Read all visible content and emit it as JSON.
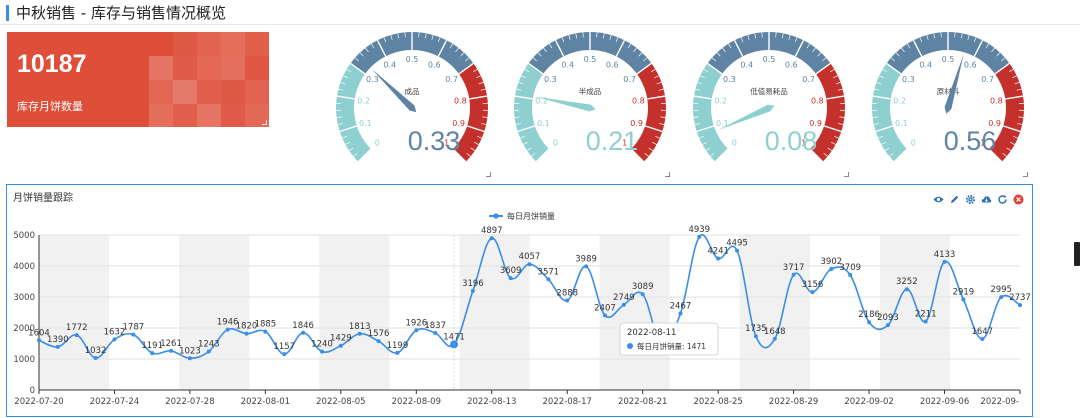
{
  "header": {
    "title": "中秋销售 - 库存与销售情况概览"
  },
  "colors": {
    "accent": "#3a8ee6",
    "card_red": "#de4e38",
    "gauge_teal": "#8ecfd0",
    "gauge_blue": "#5e83a3",
    "gauge_red": "#c4302b",
    "line": "#3a8ee6"
  },
  "stat_card": {
    "value": "10187",
    "label": "库存月饼数量"
  },
  "gauges": [
    {
      "name": "成品",
      "value": 0.33,
      "display": "0.33",
      "color": "#5e83a3"
    },
    {
      "name": "半成品",
      "value": 0.21,
      "display": "0.21",
      "color": "#8ecfd0"
    },
    {
      "name": "低值易耗品",
      "value": 0.08,
      "display": "0.08",
      "color": "#8ecfd0"
    },
    {
      "name": "原材料",
      "value": 0.56,
      "display": "0.56",
      "color": "#5e83a3"
    }
  ],
  "gauge_ticks": [
    "0",
    "0.1",
    "0.2",
    "0.3",
    "0.4",
    "0.5",
    "0.6",
    "0.7",
    "0.8",
    "0.9",
    "1"
  ],
  "chart_panel": {
    "title": "月饼销量跟踪",
    "toolbox": [
      "eye-icon",
      "pencil-icon",
      "gear-icon",
      "cloud-download-icon",
      "refresh-icon",
      "close-icon"
    ]
  },
  "chart_data": {
    "type": "line",
    "legend": "每日月饼销量",
    "ylim": [
      0,
      5000
    ],
    "yticks": [
      0,
      1000,
      2000,
      3000,
      4000,
      5000
    ],
    "x_tick_labels": [
      "2022-07-20",
      "2022-07-24",
      "2022-07-28",
      "2022-08-01",
      "2022-08-05",
      "2022-08-09",
      "2022-08-13",
      "2022-08-17",
      "2022-08-21",
      "2022-08-25",
      "2022-08-29",
      "2022-09-02",
      "2022-09-06",
      "2022-09-"
    ],
    "series": [
      {
        "name": "每日月饼销量",
        "values": [
          1604,
          1390,
          1772,
          1032,
          1632,
          1787,
          1191,
          1261,
          1023,
          1243,
          1946,
          1820,
          1885,
          1157,
          1846,
          1240,
          1429,
          1813,
          1576,
          1199,
          1926,
          1837,
          1471,
          3196,
          4897,
          3609,
          4057,
          3571,
          2888,
          3989,
          2407,
          2749,
          3089,
          1471,
          2467,
          4939,
          4241,
          4495,
          1735,
          1648,
          3717,
          3156,
          3902,
          3709,
          2186,
          2093,
          3252,
          2211,
          4133,
          2919,
          1647,
          2995,
          2737
        ]
      }
    ],
    "point_labels": [
      "1604",
      "1390",
      "1772",
      "1032",
      "1632",
      "1787",
      "1191",
      "1261",
      "1023",
      "1243",
      "1946",
      "1820",
      "1885",
      "1157",
      "1846",
      "1240",
      "1429",
      "1813",
      "1576",
      "1199",
      "1926",
      "1837",
      "1471",
      "3196",
      "4897",
      "3609",
      "4057",
      "3571",
      "2888",
      "3989",
      "2407",
      "2749",
      "3089",
      "",
      "2467",
      "4939",
      "4241",
      "4495",
      "1735",
      "1648",
      "3717",
      "3156",
      "3902",
      "3709",
      "2186",
      "2093",
      "3252",
      "2211",
      "4133",
      "2919",
      "1647",
      "2995",
      "2737"
    ],
    "highlight_index": 22,
    "grid": true
  },
  "tooltip": {
    "date": "2022-08-11",
    "text": "每日月饼销量: 1471"
  }
}
